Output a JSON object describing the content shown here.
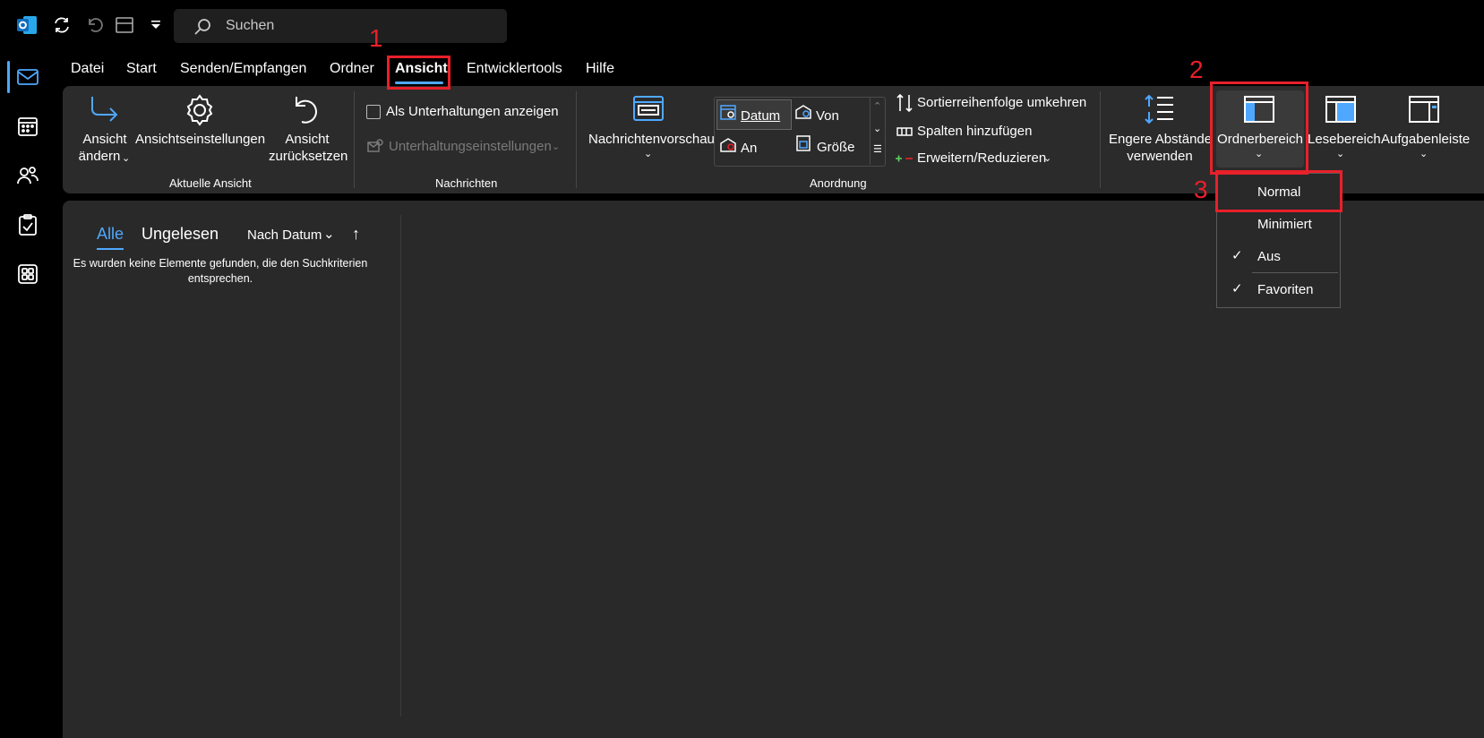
{
  "titlebar": {
    "search_placeholder": "Suchen"
  },
  "menu": {
    "tabs": [
      {
        "label": "Datei"
      },
      {
        "label": "Start"
      },
      {
        "label": "Senden/Empfangen"
      },
      {
        "label": "Ordner"
      },
      {
        "label": "Ansicht",
        "active": true
      },
      {
        "label": "Entwicklertools"
      },
      {
        "label": "Hilfe"
      }
    ]
  },
  "ribbon": {
    "aktuelle_ansicht": {
      "label": "Aktuelle Ansicht",
      "ansicht_aendern_1": "Ansicht",
      "ansicht_aendern_2": "ändern",
      "einstellungen": "Ansichtseinstellungen",
      "zuruecksetzen_1": "Ansicht",
      "zuruecksetzen_2": "zurücksetzen"
    },
    "nachrichten": {
      "label": "Nachrichten",
      "unterhaltungen": "Als Unterhaltungen anzeigen",
      "unterhaltungseinstellungen": "Unterhaltungseinstellungen"
    },
    "anordnung": {
      "label": "Anordnung",
      "vorschau": "Nachrichtenvorschau",
      "datum": "Datum",
      "von": "Von",
      "an": "An",
      "groesse": "Größe",
      "sortier": "Sortierreihenfolge umkehren",
      "spalten": "Spalten hinzufügen",
      "erweitern": "Erweitern/Reduzieren"
    },
    "layout": {
      "abstaende_1": "Engere Abstände",
      "abstaende_2": "verwenden",
      "ordnerbereich": "Ordnerbereich",
      "lesebereich": "Lesebereich",
      "aufgabenleiste": "Aufgabenleiste"
    }
  },
  "dropdown": {
    "items": [
      {
        "label": "Normal",
        "checked": false
      },
      {
        "label": "Minimiert",
        "checked": false
      },
      {
        "label": "Aus",
        "checked": true
      },
      {
        "label": "Favoriten",
        "checked": true
      }
    ]
  },
  "list": {
    "tab_all": "Alle",
    "tab_unread": "Ungelesen",
    "sort": "Nach Datum",
    "sort_arrow": "↑",
    "empty_1": "Es wurden keine Elemente gefunden, die den Suchkriterien",
    "empty_2": "entsprechen."
  },
  "annotations": [
    "1",
    "2",
    "3"
  ],
  "colors": {
    "accent": "#4fa8ff",
    "highlight": "#e8202a"
  }
}
